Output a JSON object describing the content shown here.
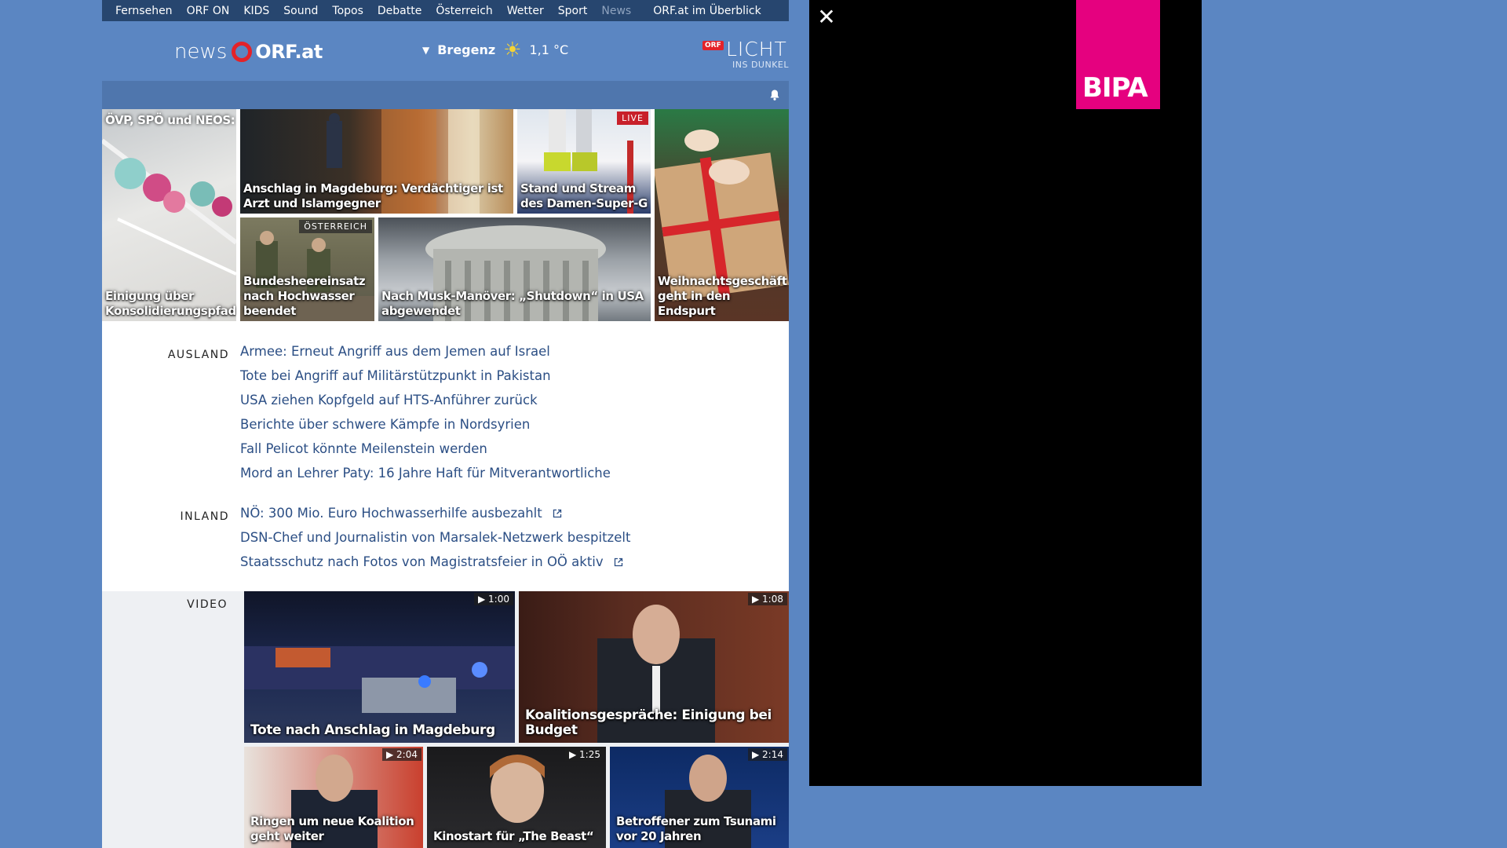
{
  "topnav": [
    "Fernsehen",
    "ORF ON",
    "KIDS",
    "Sound",
    "Topos",
    "Debatte",
    "Österreich",
    "Wetter",
    "Sport",
    "News"
  ],
  "topnav_overview": "ORF.at im Überblick",
  "logo": {
    "news": "news",
    "orf": "ORF.at"
  },
  "weather": {
    "city": "Bregenz",
    "temp": "1,1 °C",
    "icon": "sun-icon"
  },
  "licht": {
    "badge": "ORF",
    "title": "LICHT",
    "sub": "INS DUNKEL"
  },
  "tiles": {
    "t1": {
      "top": "ÖVP, SPÖ und NEOS:",
      "caption": "Einigung über Konsolidierungspfad"
    },
    "t2": {
      "caption": "Anschlag in Magdeburg: Verdächtiger ist Arzt und Islamgegner"
    },
    "t3": {
      "caption": "Stand und Stream des Damen-Super-G",
      "tag": "LIVE"
    },
    "t4": {
      "caption": "Weihnachtsgeschäft geht in den Endspurt"
    },
    "t5": {
      "caption": "Bundesheereinsatz nach Hochwasser beendet",
      "tag": "ÖSTERREICH"
    },
    "t6": {
      "caption": "Nach Musk-Manöver: „Shutdown“ in USA abgewendet"
    }
  },
  "ausland": {
    "label": "AUSLAND",
    "items": [
      "Armee: Erneut Angriff aus dem Jemen auf Israel",
      "Tote bei Angriff auf Militärstützpunkt in Pakistan",
      "USA ziehen Kopfgeld auf HTS-Anführer zurück",
      "Berichte über schwere Kämpfe in Nordsyrien",
      "Fall Pelicot könnte Meilenstein werden",
      "Mord an Lehrer Paty: 16 Jahre Haft für Mitverantwortliche"
    ]
  },
  "inland": {
    "label": "INLAND",
    "items": [
      "NÖ: 300 Mio. Euro Hochwasserhilfe ausbezahlt",
      "DSN-Chef und Journalistin von Marsalek-Netzwerk bespitzelt",
      "Staatsschutz nach Fotos von Magistratsfeier in OÖ aktiv"
    ]
  },
  "video": {
    "label": "VIDEO",
    "items": [
      {
        "caption": "Tote nach Anschlag in Magdeburg",
        "duration": "1:00"
      },
      {
        "caption": "Koalitionsgespräche: Einigung bei Budget",
        "duration": "1:08"
      },
      {
        "caption": "Ringen um neue Koalition geht weiter",
        "duration": "2:04"
      },
      {
        "caption": "Kinostart für „The Beast“",
        "duration": "1:25"
      },
      {
        "caption": "Betroffener zum Tsunami vor 20 Jahren",
        "duration": "2:14"
      }
    ]
  },
  "ad": {
    "brand": "BIPA",
    "close": "✕"
  },
  "colors": {
    "nav": "#27466f",
    "accent": "#e32229",
    "link": "#2b4e84",
    "background": "#5b86c2",
    "ad_brand": "#e5017f"
  }
}
